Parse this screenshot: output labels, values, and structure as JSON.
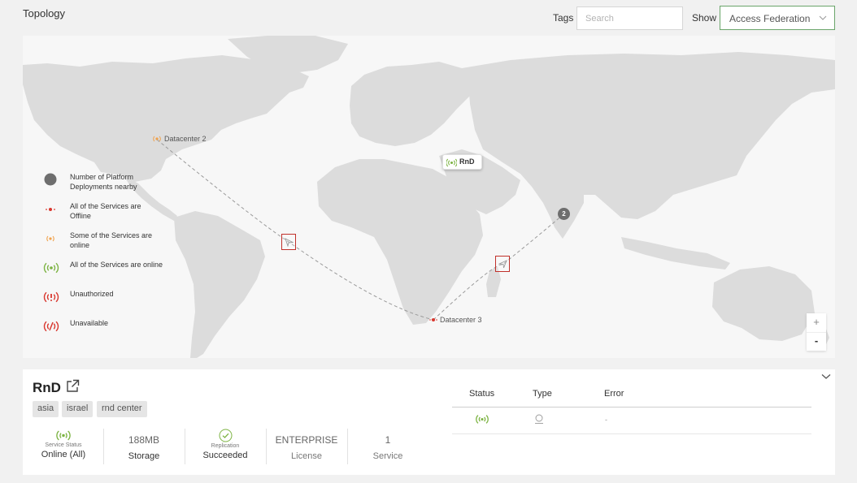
{
  "header": {
    "title": "Topology",
    "tags_label": "Tags",
    "search_placeholder": "Search",
    "show_label": "Show",
    "show_selected": "Access Federation"
  },
  "colors": {
    "online": "#7cb342",
    "partial": "#f0a14b",
    "offline": "#d9372e",
    "land": "#dcdcdc",
    "ocean": "#f7f7f7",
    "cluster": "#6e6e6e",
    "route_line": "#9a9a9a",
    "highlight_box": "#c0302a"
  },
  "legend": [
    {
      "icon": "cluster-dot-icon",
      "text": "Number of Platform Deployments nearby"
    },
    {
      "icon": "offline-dot-icon",
      "text": "All of the Services are Offline"
    },
    {
      "icon": "partial-signal-icon",
      "text": "Some of the Services are online"
    },
    {
      "icon": "online-signal-icon",
      "text": "All of the Services are online"
    },
    {
      "icon": "unauthorized-signal-icon",
      "text": "Unauthorized"
    },
    {
      "icon": "unavailable-signal-icon",
      "text": "Unavailable"
    }
  ],
  "map": {
    "markers": {
      "datacenter2": "Datacenter 2",
      "datacenter3": "Datacenter 3",
      "rnd": "RnD",
      "cluster_count": "2"
    },
    "zoom_in": "+",
    "zoom_out": "-"
  },
  "details": {
    "title": "RnD",
    "tags": [
      "asia",
      "israel",
      "rnd center"
    ],
    "stats": {
      "service_status_label": "Service Status",
      "service_status_value": "Online (All)",
      "storage_value": "188MB",
      "storage_label": "Storage",
      "replication_label": "Replication",
      "replication_value": "Succeeded",
      "license_value": "ENTERPRISE",
      "license_label": "License",
      "service_count": "1",
      "service_label": "Service"
    },
    "table": {
      "headers": [
        "Status",
        "Type",
        "Error"
      ],
      "rows": [
        {
          "status": "online-signal-icon",
          "type": "service-type-icon",
          "error": "-"
        }
      ]
    }
  }
}
